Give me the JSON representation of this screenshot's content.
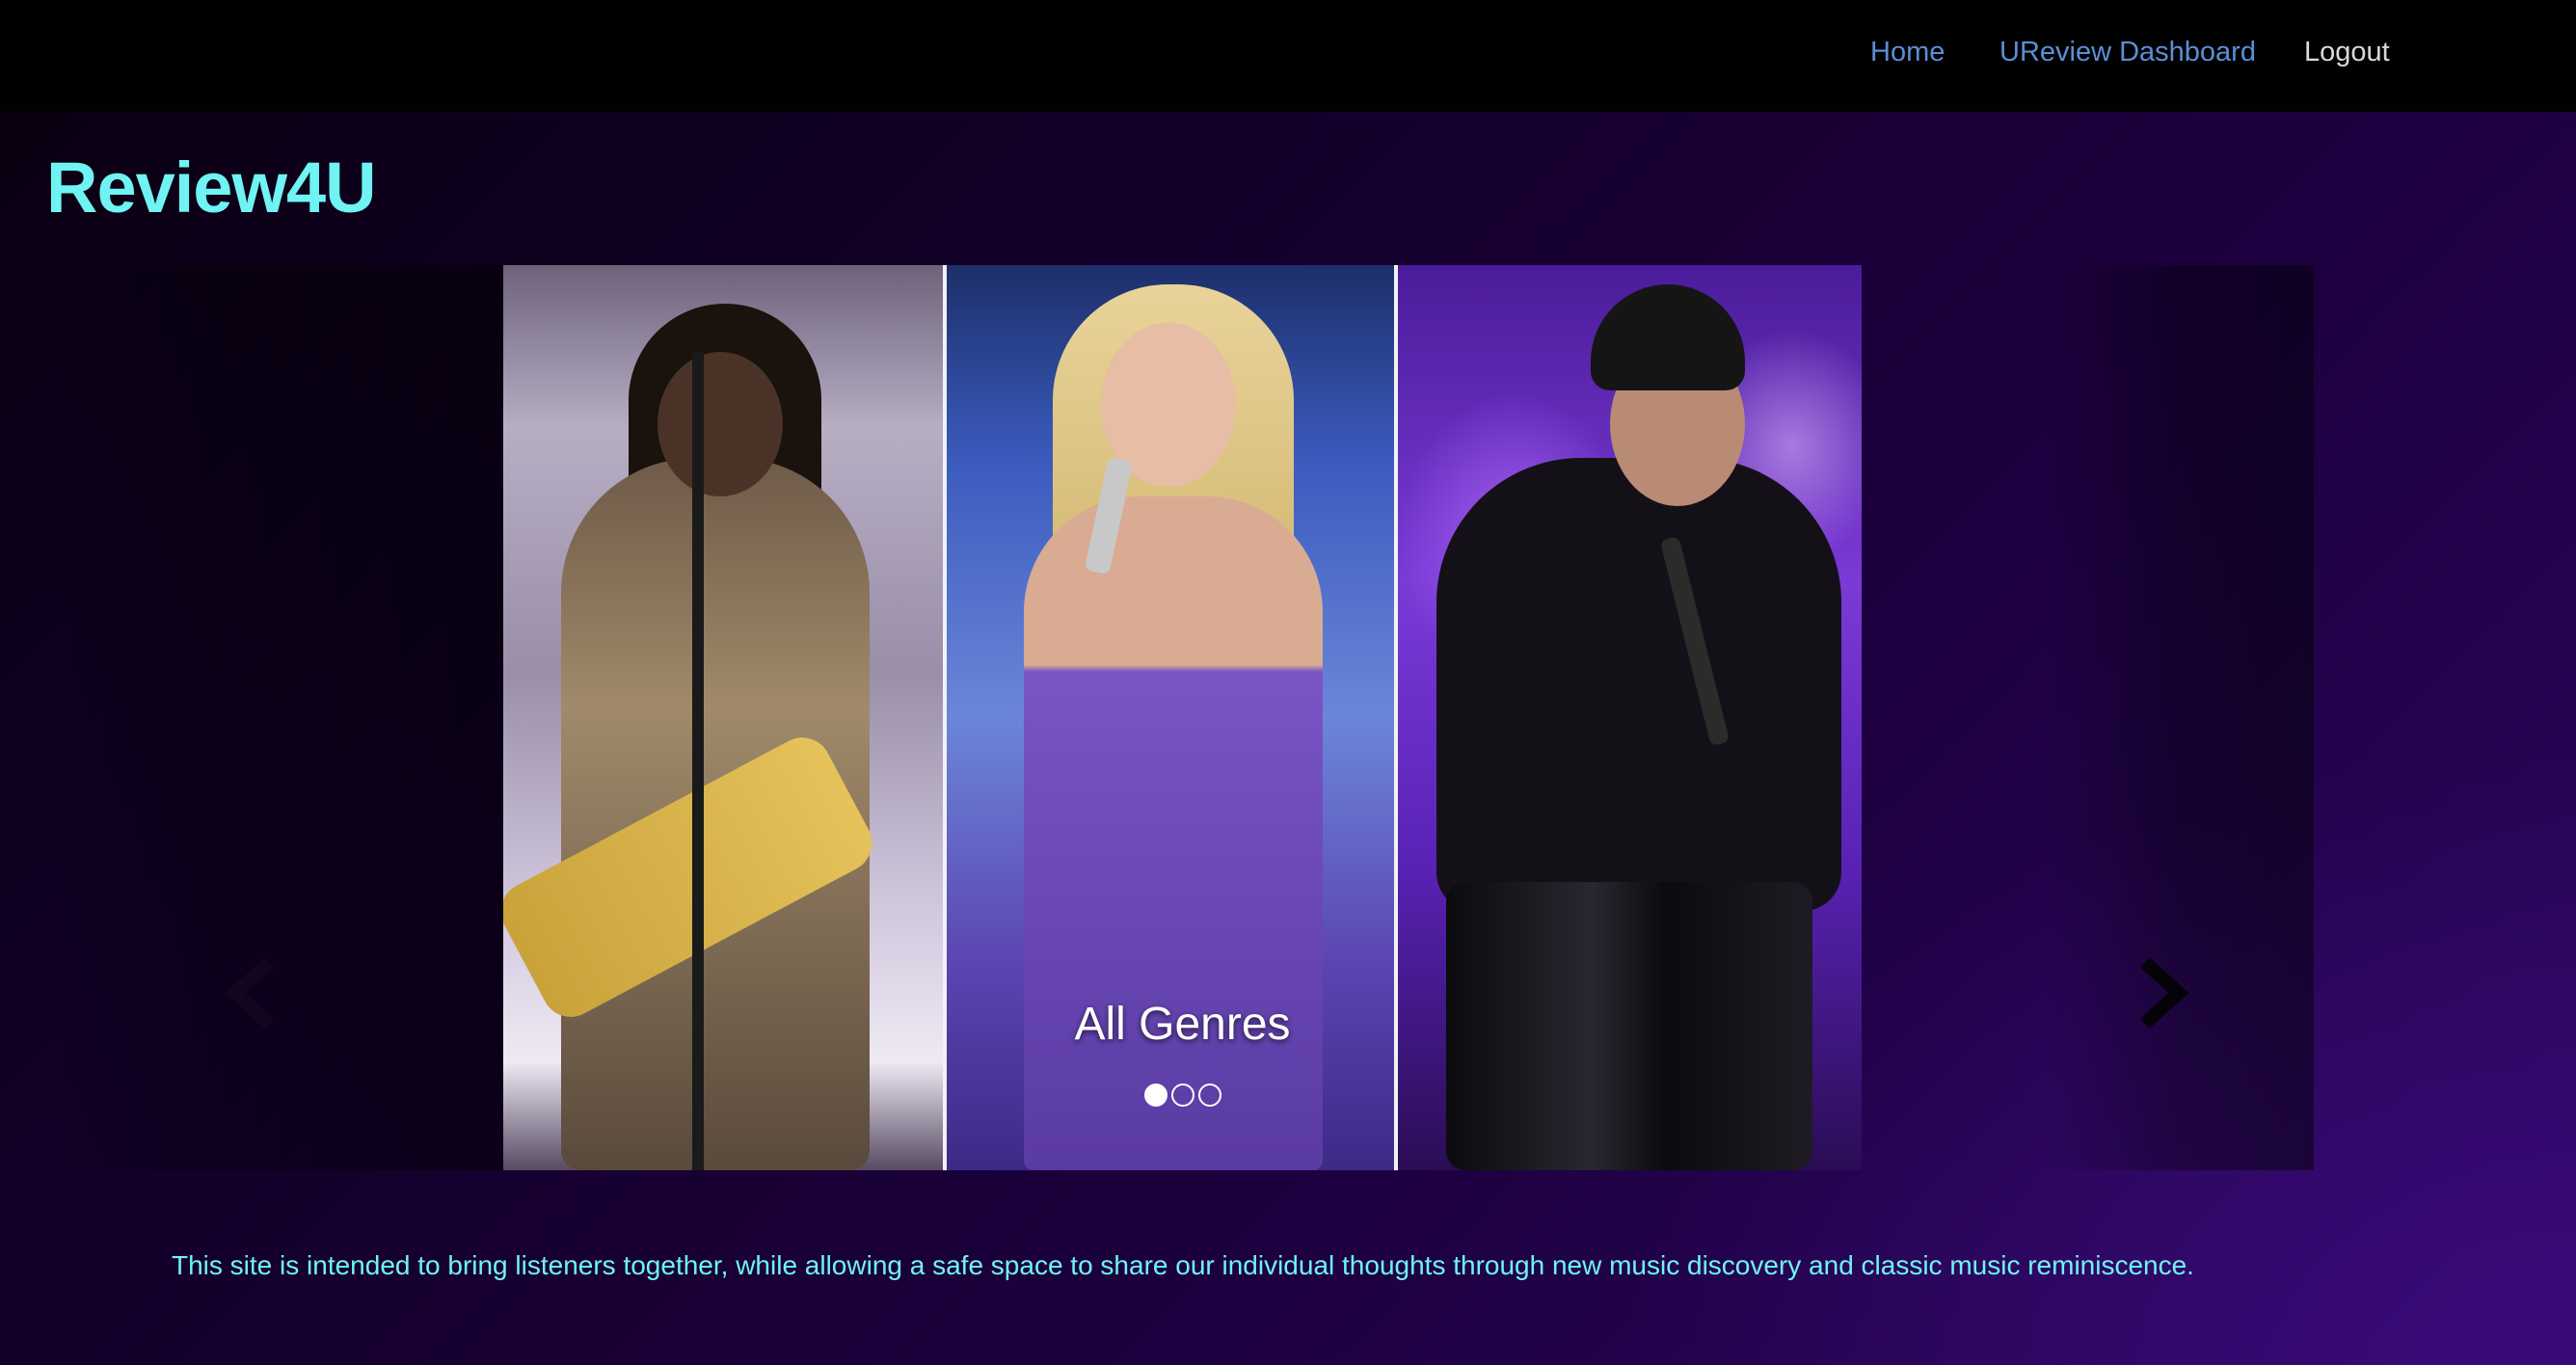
{
  "nav": {
    "home": "Home",
    "dashboard": "UReview Dashboard",
    "logout": "Logout"
  },
  "site": {
    "title": "Review4U"
  },
  "carousel": {
    "caption": "All Genres",
    "slide_count": 3,
    "active_slide": 1,
    "prev_icon": "chevron-left-icon",
    "next_icon": "chevron-right-icon"
  },
  "intro": {
    "text": "This site is intended to bring listeners together, while allowing a safe space to share our individual thoughts through new music discovery and classic music reminiscence."
  },
  "colors": {
    "title": "#6ff3f3",
    "nav_link": "#5a8fd6",
    "nav_logout": "#d9d9d9",
    "navbar_bg": "#020102",
    "page_bg": "#14002a"
  }
}
